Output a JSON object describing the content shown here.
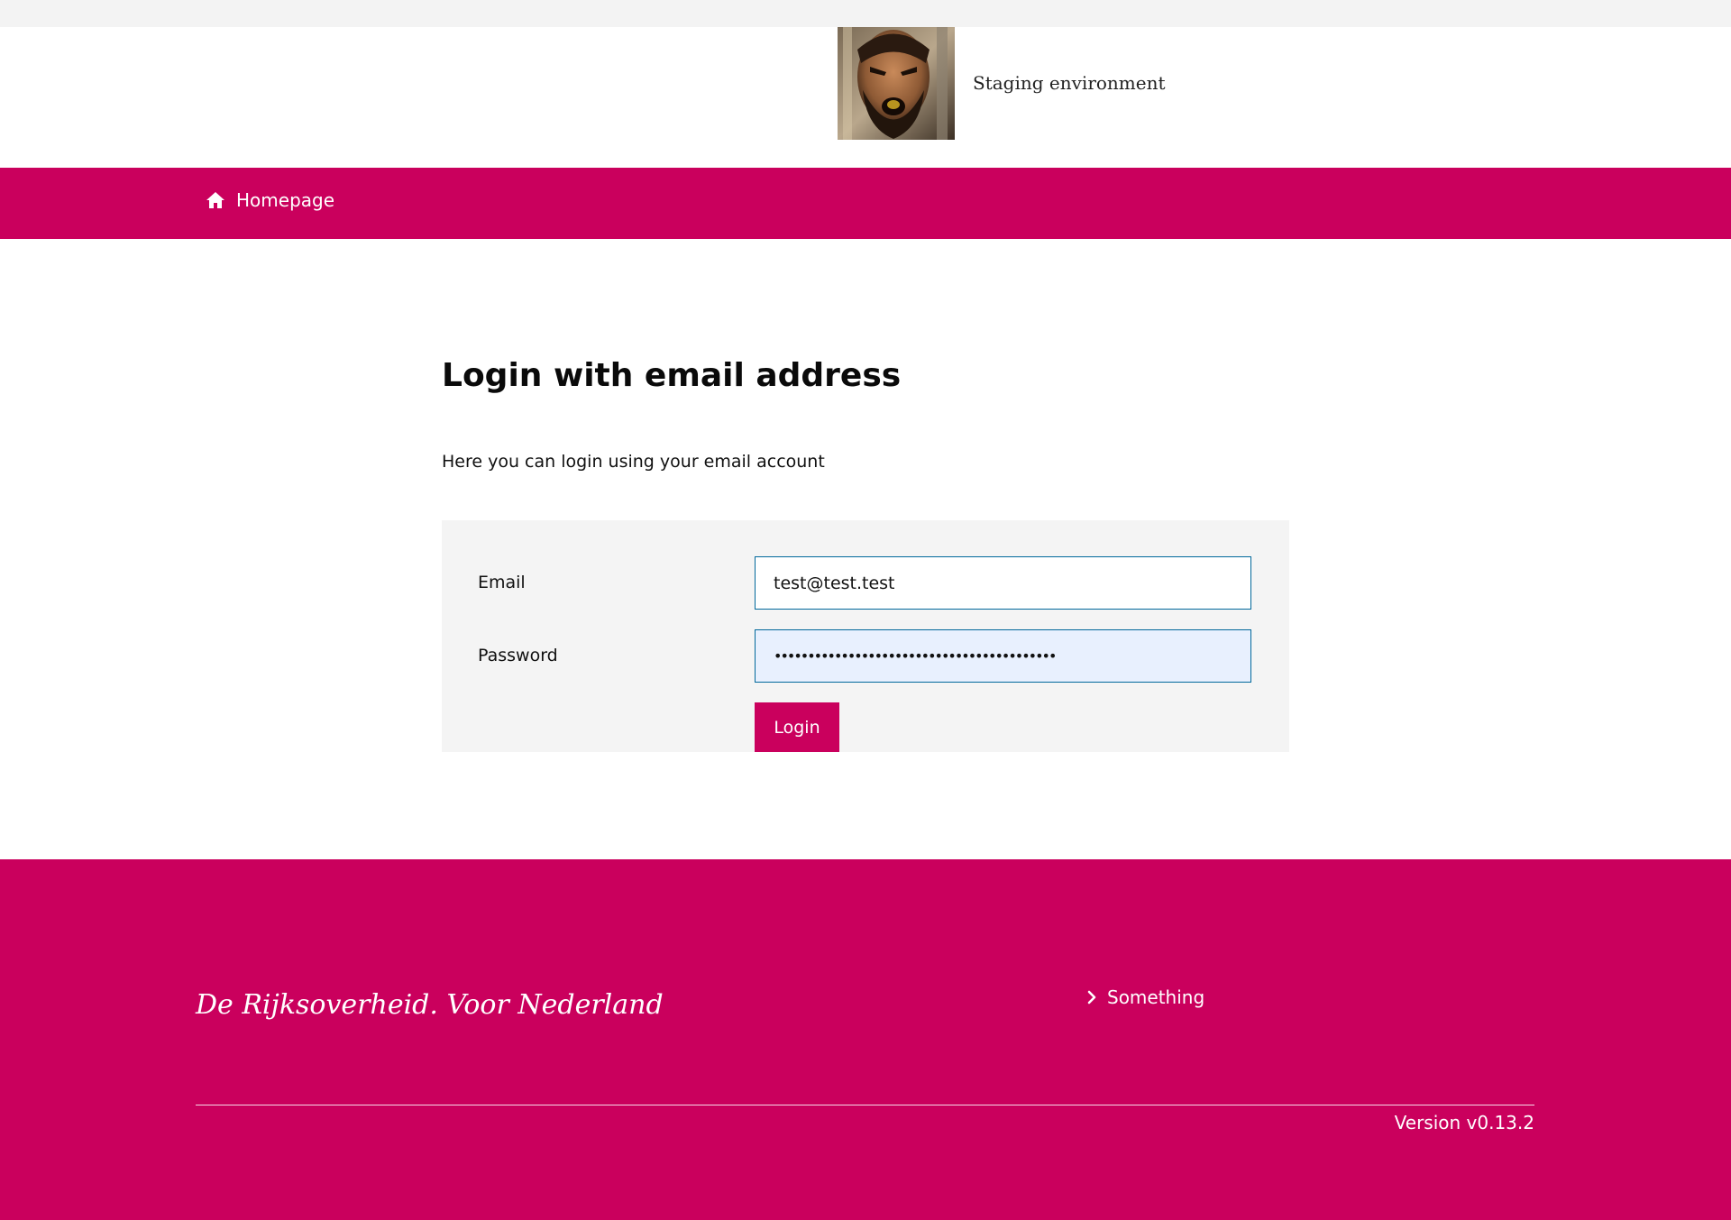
{
  "header": {
    "site_name": "Staging environment",
    "logo_icon": "profile-photo"
  },
  "nav": {
    "home_label": "Homepage",
    "home_icon": "home-icon"
  },
  "main": {
    "title": "Login with email address",
    "intro": "Here you can login using your email account",
    "form": {
      "email_label": "Email",
      "email_value": "test@test.test",
      "password_label": "Password",
      "password_value": "••••••••••••••••••••••••••••••••••••••••••",
      "login_label": "Login"
    }
  },
  "footer": {
    "tagline": "De Rijksoverheid. Voor Nederland",
    "link_label": "Something",
    "link_icon": "chevron-right-icon",
    "version": "Version v0.13.2"
  },
  "colors": {
    "brand": "#ca005d",
    "field_border": "#01689b",
    "form_background": "#f4f4f4",
    "autofill_background": "#e8f0fe"
  }
}
